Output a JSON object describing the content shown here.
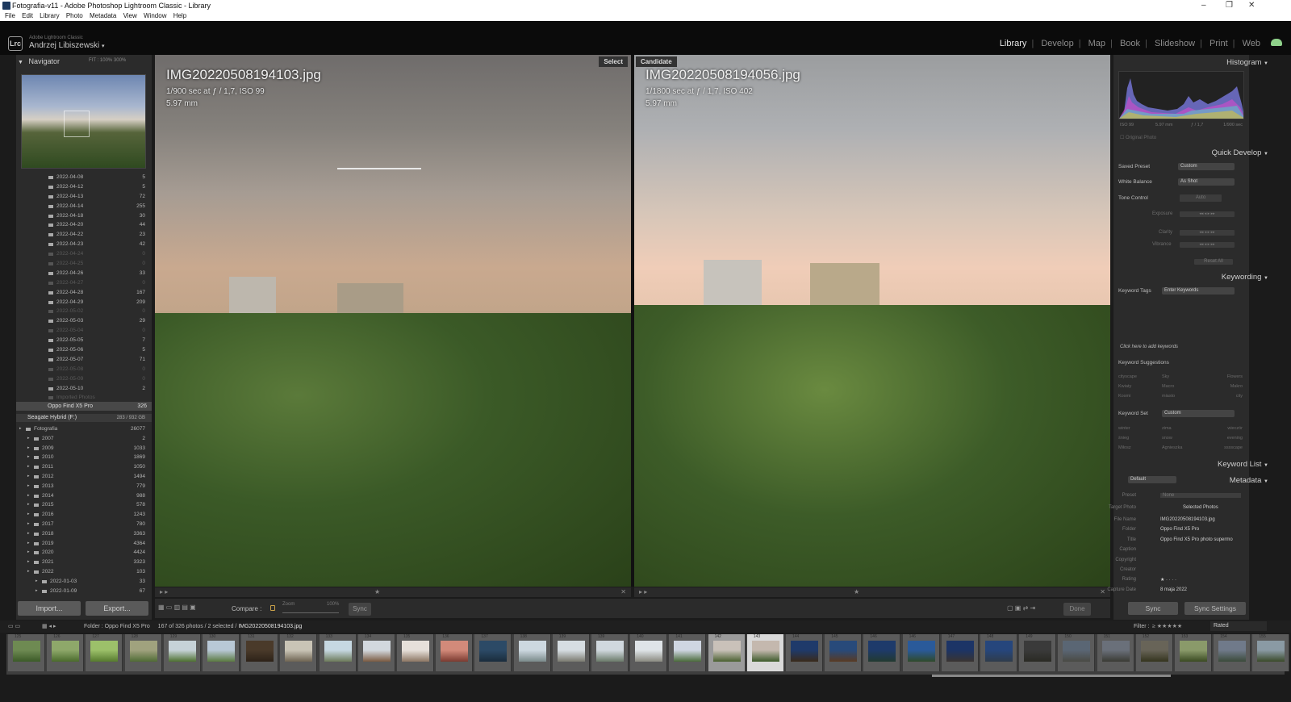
{
  "window": {
    "title": "Fotografia-v11 - Adobe Photoshop Lightroom Classic - Library",
    "menu": [
      "File",
      "Edit",
      "Library",
      "Photo",
      "Metadata",
      "View",
      "Window",
      "Help"
    ],
    "controls": [
      "–",
      "❐",
      "✕"
    ]
  },
  "identity": {
    "logo": "Lrc",
    "product": "Adobe Lightroom Classic",
    "user": "Andrzej Libiszewski"
  },
  "modules": [
    "Library",
    "Develop",
    "Map",
    "Book",
    "Slideshow",
    "Print",
    "Web"
  ],
  "active_module": "Library",
  "navigator": {
    "title": "Navigator",
    "zoom_options": "FIT  :  100%  300%"
  },
  "folders_top": [
    {
      "name": "2022-04-08",
      "count": "5",
      "dim": false
    },
    {
      "name": "2022-04-12",
      "count": "5",
      "dim": false
    },
    {
      "name": "2022-04-13",
      "count": "72",
      "dim": false
    },
    {
      "name": "2022-04-14",
      "count": "255",
      "dim": false
    },
    {
      "name": "2022-04-18",
      "count": "30",
      "dim": false
    },
    {
      "name": "2022-04-20",
      "count": "44",
      "dim": false
    },
    {
      "name": "2022-04-22",
      "count": "23",
      "dim": false
    },
    {
      "name": "2022-04-23",
      "count": "42",
      "dim": false
    },
    {
      "name": "2022-04-24",
      "count": "0",
      "dim": true
    },
    {
      "name": "2022-04-25",
      "count": "0",
      "dim": true
    },
    {
      "name": "2022-04-26",
      "count": "33",
      "dim": false
    },
    {
      "name": "2022-04-27",
      "count": "0",
      "dim": true
    },
    {
      "name": "2022-04-28",
      "count": "167",
      "dim": false
    },
    {
      "name": "2022-04-29",
      "count": "209",
      "dim": false
    },
    {
      "name": "2022-05-02",
      "count": "0",
      "dim": true
    },
    {
      "name": "2022-05-03",
      "count": "29",
      "dim": false
    },
    {
      "name": "2022-05-04",
      "count": "0",
      "dim": true
    },
    {
      "name": "2022-05-05",
      "count": "7",
      "dim": false
    },
    {
      "name": "2022-05-06",
      "count": "5",
      "dim": false
    },
    {
      "name": "2022-05-07",
      "count": "71",
      "dim": false
    },
    {
      "name": "2022-05-08",
      "count": "0",
      "dim": true
    },
    {
      "name": "2022-05-09",
      "count": "0",
      "dim": true
    },
    {
      "name": "2022-05-10",
      "count": "2",
      "dim": false
    },
    {
      "name": "Imported Photos",
      "count": "",
      "dim": true
    }
  ],
  "oppo_folder": {
    "name": "Oppo Find X5 Pro",
    "count": "326"
  },
  "drive": {
    "name": "Seagate Hybrid (F:)",
    "space": "283 / 932 GB"
  },
  "drive_folders": [
    {
      "name": "Fotografia",
      "count": "26077",
      "indent": 1
    },
    {
      "name": "2007",
      "count": "2",
      "indent": 2
    },
    {
      "name": "2009",
      "count": "1033",
      "indent": 2
    },
    {
      "name": "2010",
      "count": "1869",
      "indent": 2
    },
    {
      "name": "2011",
      "count": "1050",
      "indent": 2
    },
    {
      "name": "2012",
      "count": "1494",
      "indent": 2
    },
    {
      "name": "2013",
      "count": "779",
      "indent": 2
    },
    {
      "name": "2014",
      "count": "988",
      "indent": 2
    },
    {
      "name": "2015",
      "count": "578",
      "indent": 2
    },
    {
      "name": "2016",
      "count": "1243",
      "indent": 2
    },
    {
      "name": "2017",
      "count": "780",
      "indent": 2
    },
    {
      "name": "2018",
      "count": "3363",
      "indent": 2
    },
    {
      "name": "2019",
      "count": "4364",
      "indent": 2
    },
    {
      "name": "2020",
      "count": "4424",
      "indent": 2
    },
    {
      "name": "2021",
      "count": "3323",
      "indent": 2
    },
    {
      "name": "2022",
      "count": "103",
      "indent": 2
    },
    {
      "name": "2022-01-03",
      "count": "33",
      "indent": 3
    },
    {
      "name": "2022-01-09",
      "count": "67",
      "indent": 3
    }
  ],
  "left_buttons": {
    "import": "Import...",
    "export": "Export..."
  },
  "select_photo": {
    "label": "Select",
    "filename": "IMG20220508194103.jpg",
    "exposure": "1/900 sec at ƒ / 1,7, ISO 99",
    "focal": "5.97 mm"
  },
  "candidate_photo": {
    "label": "Candidate",
    "filename": "IMG20220508194056.jpg",
    "exposure": "1/1800 sec at ƒ / 1,7, ISO 402",
    "focal": "5.97 mm"
  },
  "toolbar": {
    "compare_label": "Compare :",
    "zoom_label": "Zoom",
    "zoom_pct": "100%",
    "sync_label": "Sync",
    "done_label": "Done"
  },
  "histogram": {
    "title": "Histogram",
    "iso": "ISO 99",
    "focal": "5.97 mm",
    "aperture": "ƒ / 1,7",
    "shutter": "1/900 sec",
    "original_photo": "Original Photo"
  },
  "quick_develop": {
    "title": "Quick Develop",
    "saved_preset_label": "Saved Preset",
    "saved_preset_value": "Custom",
    "white_balance_label": "White Balance",
    "white_balance_value": "As Shot",
    "tone_control_label": "Tone Control",
    "tone_control_value": "Auto",
    "exposure_label": "Exposure",
    "clarity_label": "Clarity",
    "vibrance_label": "Vibrance",
    "reset_label": "Reset All"
  },
  "keywording": {
    "title": "Keywording",
    "tags_label": "Keyword Tags",
    "tags_value": "Enter Keywords",
    "click_hint": "Click here to add keywords",
    "suggestions_label": "Keyword Suggestions",
    "suggestions": [
      "cityscape",
      "Sky",
      "Flowers",
      "Kwiaty",
      "Macro",
      "Makro",
      "Kosmi",
      "miasto",
      "city"
    ],
    "set_label": "Keyword Set",
    "set_value": "Custom",
    "set_words": [
      "winter",
      "zima",
      "wieczór",
      "śnieg",
      "snow",
      "evening",
      "Miłosz",
      "Agnieszka",
      "sssscape"
    ]
  },
  "keyword_list": {
    "title": "Keyword List"
  },
  "metadata": {
    "title": "Metadata",
    "preset_dropdown": "Default",
    "preset_label": "Preset",
    "preset_value": "None",
    "target_label": "Target Photo",
    "target_value": "Selected Photos",
    "fields": [
      {
        "label": "File Name",
        "value": "IMG20220508194103.jpg"
      },
      {
        "label": "Folder",
        "value": "Oppo Find X5 Pro"
      },
      {
        "label": "Title",
        "value": "Oppo Find X5 Pro photo supermo"
      },
      {
        "label": "Caption",
        "value": ""
      },
      {
        "label": "Copyright",
        "value": ""
      },
      {
        "label": "Creator",
        "value": ""
      },
      {
        "label": "Rating",
        "value": "★ · · · ·"
      },
      {
        "label": "Capture Date",
        "value": "8 maja 2022"
      }
    ]
  },
  "right_buttons": {
    "sync": "Sync",
    "sync_settings": "Sync Settings"
  },
  "filmbar": {
    "folder": "Folder : Oppo Find X5 Pro",
    "count": "167 of 326 photos / 2 selected /",
    "selected_file": "IMG20220508194103.jpg",
    "filter_label": "Filter :",
    "filter_stars": "≥ ★★★★★",
    "filter_value": "Rated"
  },
  "filmstrip": [
    {
      "num": "125",
      "top": "#6e8a52",
      "bottom": "#3b5a28"
    },
    {
      "num": "126",
      "top": "#8ea86a",
      "bottom": "#4a6a2c"
    },
    {
      "num": "127",
      "top": "#9cc06a",
      "bottom": "#567a2e"
    },
    {
      "num": "128",
      "top": "#a0a27e",
      "bottom": "#4f6a35"
    },
    {
      "num": "129",
      "top": "#c6d2d8",
      "bottom": "#4e7030"
    },
    {
      "num": "130",
      "top": "#b8c8d6",
      "bottom": "#5a7a40"
    },
    {
      "num": "131",
      "top": "#4a3a2a",
      "bottom": "#2d2218"
    },
    {
      "num": "132",
      "top": "#c9c4b6",
      "bottom": "#6e6452"
    },
    {
      "num": "133",
      "top": "#c6d8e2",
      "bottom": "#6c7a5a"
    },
    {
      "num": "134",
      "top": "#d2d8de",
      "bottom": "#7a5a40"
    },
    {
      "num": "135",
      "top": "#e6e0da",
      "bottom": "#8c7664"
    },
    {
      "num": "136",
      "top": "#d28a7a",
      "bottom": "#7a3a30"
    },
    {
      "num": "137",
      "top": "#2c4a66",
      "bottom": "#1a2c3c"
    },
    {
      "num": "138",
      "top": "#cdd8e0",
      "bottom": "#7a8a8a"
    },
    {
      "num": "139",
      "top": "#d6dde2",
      "bottom": "#7a7a70"
    },
    {
      "num": "139",
      "top": "#d0d8de",
      "bottom": "#6a7a6a"
    },
    {
      "num": "140",
      "top": "#dfe4e8",
      "bottom": "#8a8a80"
    },
    {
      "num": "141",
      "top": "#cfd6e2",
      "bottom": "#4a6a3a"
    },
    {
      "num": "142",
      "top": "#c9c1b9",
      "bottom": "#4a6030"
    },
    {
      "num": "143",
      "top": "#c4b8ae",
      "bottom": "#3c5a2a"
    },
    {
      "num": "144",
      "top": "#1f3a6a",
      "bottom": "#3a2a1a"
    },
    {
      "num": "145",
      "top": "#284a7a",
      "bottom": "#5a3a22"
    },
    {
      "num": "146",
      "top": "#1e3a6a",
      "bottom": "#223a30"
    },
    {
      "num": "146",
      "top": "#2a5a9a",
      "bottom": "#2f4a2a"
    },
    {
      "num": "147",
      "top": "#1c3466",
      "bottom": "#3a3430"
    },
    {
      "num": "148",
      "top": "#26467c",
      "bottom": "#2f3c4a"
    },
    {
      "num": "149",
      "top": "#3a3a3a",
      "bottom": "#2a2a24"
    },
    {
      "num": "150",
      "top": "#5a6674",
      "bottom": "#4a4a44"
    },
    {
      "num": "151",
      "top": "#6a707a",
      "bottom": "#3a3a34"
    },
    {
      "num": "152",
      "top": "#686458",
      "bottom": "#34341e"
    },
    {
      "num": "153",
      "top": "#8a9a6a",
      "bottom": "#3a4a22"
    },
    {
      "num": "154",
      "top": "#707a8a",
      "bottom": "#3a4a3a"
    },
    {
      "num": "155",
      "top": "#8a9aa4",
      "bottom": "#3a4a2a"
    }
  ],
  "colors": {
    "panel_bg": "#2b2b2b",
    "app_bg": "#1b1b1b",
    "accent_select": "#d9d9d9"
  }
}
